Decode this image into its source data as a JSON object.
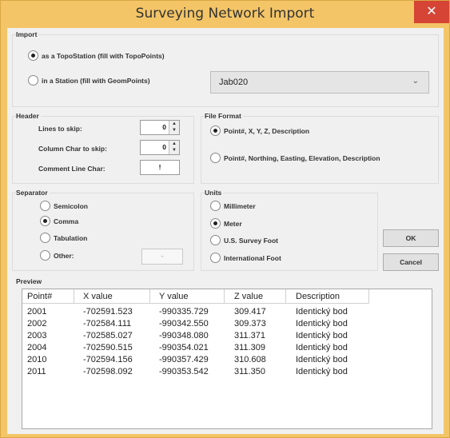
{
  "window": {
    "title": "Surveying Network Import",
    "close_glyph": "✕"
  },
  "import": {
    "label": "Import",
    "option1": "as a TopoStation (fill with TopoPoints)",
    "option2": "in a Station (fill with GeomPoints)",
    "station_value": "Jab020",
    "dropdown_glyph": "⌄"
  },
  "header": {
    "label": "Header",
    "lines_to_skip_label": "Lines to skip:",
    "lines_to_skip_value": "0",
    "column_char_label": "Column Char to skip:",
    "column_char_value": "0",
    "comment_char_label": "Comment Line Char:",
    "comment_char_value": "!"
  },
  "file_format": {
    "label": "File Format",
    "option1": "Point#, X, Y, Z, Description",
    "option2": "Point#, Northing, Easting, Elevation, Description"
  },
  "separator": {
    "label": "Separator",
    "semicolon": "Semicolon",
    "comma": "Comma",
    "tabulation": "Tabulation",
    "other": "Other:",
    "other_value": "-"
  },
  "units": {
    "label": "Units",
    "millimeter": "Millimeter",
    "meter": "Meter",
    "us_foot": "U.S. Survey Foot",
    "intl_foot": "International Foot"
  },
  "buttons": {
    "ok": "OK",
    "cancel": "Cancel"
  },
  "preview": {
    "label": "Preview",
    "columns": [
      "Point#",
      "X value",
      "Y value",
      "Z value",
      "Description"
    ],
    "rows": [
      [
        "2001",
        "-702591.523",
        "-990335.729",
        "309.417",
        "Identický bod"
      ],
      [
        "2002",
        "-702584.111",
        "-990342.550",
        "309.373",
        "Identický bod"
      ],
      [
        "2003",
        "-702585.027",
        "-990348.080",
        "311.371",
        "Identický bod"
      ],
      [
        "2004",
        "-702590.515",
        "-990354.021",
        "311.309",
        "Identický bod"
      ],
      [
        "2010",
        "-702594.156",
        "-990357.429",
        "310.608",
        "Identický bod"
      ],
      [
        "2011",
        "-702598.092",
        "-990353.542",
        "311.350",
        "Identický bod"
      ]
    ]
  },
  "colors": {
    "titlebar": "#f3c567",
    "close_button": "#d64436",
    "dialog_bg": "#f0f0f0"
  }
}
